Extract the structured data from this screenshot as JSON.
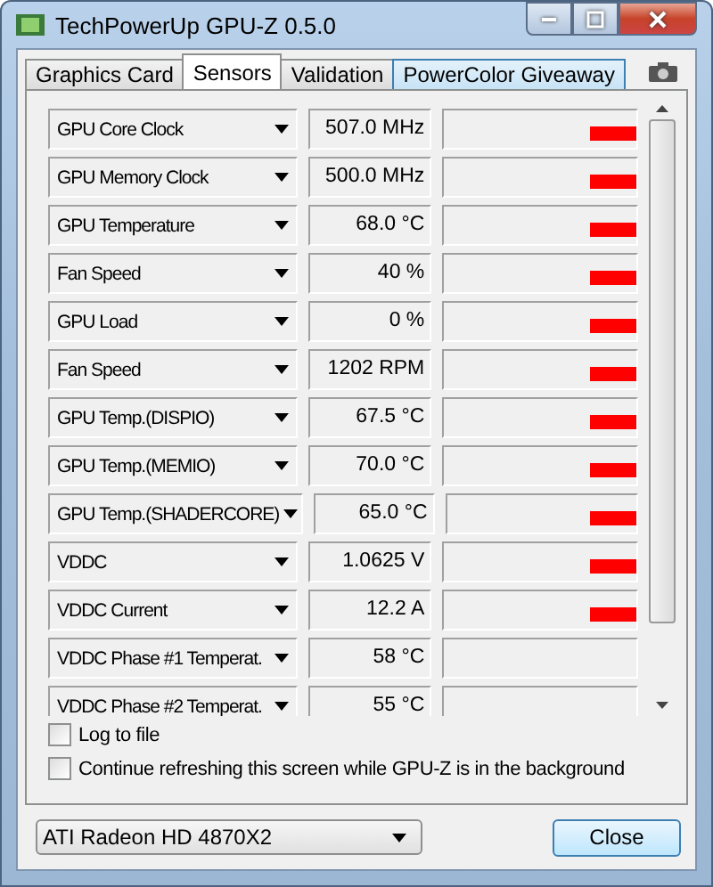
{
  "window": {
    "title": "TechPowerUp GPU-Z 0.5.0"
  },
  "tabs": [
    {
      "label": "Graphics Card",
      "selected": false
    },
    {
      "label": "Sensors",
      "selected": true
    },
    {
      "label": "Validation",
      "selected": false
    },
    {
      "label": "PowerColor Giveaway",
      "selected": false,
      "kind": "promo"
    }
  ],
  "sensors": [
    {
      "name": "GPU Core Clock",
      "reading": "507.0 MHz",
      "graph_shown": true
    },
    {
      "name": "GPU Memory Clock",
      "reading": "500.0 MHz",
      "graph_shown": true
    },
    {
      "name": "GPU Temperature",
      "reading": "68.0 °C",
      "graph_shown": true
    },
    {
      "name": "Fan Speed",
      "reading": "40 %",
      "graph_shown": true
    },
    {
      "name": "GPU Load",
      "reading": "0 %",
      "graph_shown": true
    },
    {
      "name": "Fan Speed",
      "reading": "1202 RPM",
      "graph_shown": true
    },
    {
      "name": "GPU Temp.(DISPIO)",
      "reading": "67.5 °C",
      "graph_shown": true
    },
    {
      "name": "GPU Temp.(MEMIO)",
      "reading": "70.0 °C",
      "graph_shown": true
    },
    {
      "name": "GPU Temp.(SHADERCORE)",
      "reading": "65.0 °C",
      "graph_shown": true
    },
    {
      "name": "VDDC",
      "reading": "1.0625 V",
      "graph_shown": true
    },
    {
      "name": "VDDC Current",
      "reading": "12.2 A",
      "graph_shown": true
    },
    {
      "name": "VDDC Phase #1 Temperat.",
      "reading": "58 °C",
      "graph_shown": false
    },
    {
      "name": "VDDC Phase #2 Temperat.",
      "reading": "55 °C",
      "graph_shown": false
    }
  ],
  "options": [
    {
      "label": "Log to file",
      "checked": false
    },
    {
      "label": "Continue refreshing this screen while GPU-Z is in the background",
      "checked": false
    }
  ],
  "gpu_select": {
    "value": "ATI Radeon HD 4870X2"
  },
  "buttons": [
    {
      "label": "Close"
    }
  ]
}
